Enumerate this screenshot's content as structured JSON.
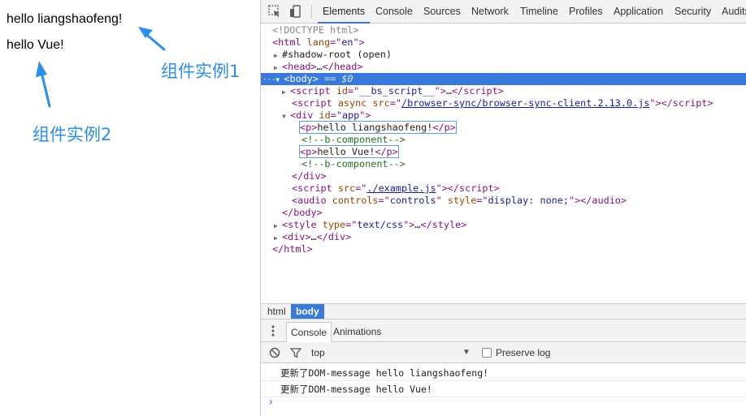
{
  "page": {
    "line1": "hello liangshaofeng!",
    "line2": "hello Vue!",
    "annotation1": "组件实例1",
    "annotation2": "组件实例2"
  },
  "devtools": {
    "tabs": [
      "Elements",
      "Console",
      "Sources",
      "Network",
      "Timeline",
      "Profiles",
      "Application",
      "Security",
      "Audits"
    ],
    "active_tab": "Elements",
    "tree": {
      "doctype": "<!DOCTYPE html>",
      "html_open_tag": "html",
      "html_lang_attr": "lang",
      "html_lang_val": "en",
      "shadow_root": "#shadow-root (open)",
      "head_tag": "head",
      "body_tag": "body",
      "body_suffix": "== $0",
      "script1_attr": "id",
      "script1_val": "__bs_script__",
      "script2_attr1": "async",
      "script2_attr2": "src",
      "script2_val": "/browser-sync/browser-sync-client.2.13.0.js",
      "div_attr": "id",
      "div_val": "app",
      "p1_text": "hello liangshaofeng!",
      "comment1": "<!--b-component-->",
      "p2_text": "hello Vue!",
      "comment2": "<!--b-component-->",
      "script3_val": "./example.js",
      "audio_attr1": "controls",
      "audio_val1": "controls",
      "audio_attr2": "style",
      "audio_val2": "display: none;",
      "style_attr": "type",
      "style_val": "text/css"
    },
    "breadcrumbs": [
      "html",
      "body"
    ],
    "drawer_tabs": [
      "Console",
      "Animations"
    ],
    "console_toolbar": {
      "context": "top",
      "preserve_log_label": "Preserve log",
      "preserve_log_checked": false
    },
    "console_messages": [
      "更新了DOM-message hello liangshaofeng!",
      "更新了DOM-message hello Vue!"
    ],
    "prompt_symbol": "›",
    "colors": {
      "selection": "#3879d9",
      "annotation": "#2a8ef0",
      "tag": "#881280",
      "attr_name": "#994500",
      "attr_value": "#1a1aa6",
      "comment": "#236e25"
    }
  }
}
